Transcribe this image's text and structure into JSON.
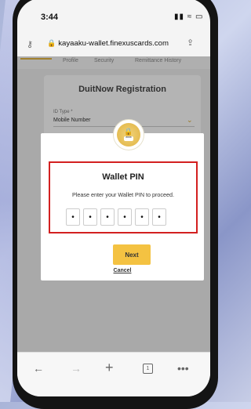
{
  "status": {
    "time": "3:44"
  },
  "browser": {
    "url": "kayaaku-wallet.finexuscards.com",
    "tabs_count": "1"
  },
  "page": {
    "tabs": [
      "",
      "Profile",
      "Security",
      "Remittance History"
    ],
    "card_title": "DuitNow Registration",
    "id_type_label": "ID Type *",
    "id_type_value": "Mobile Number"
  },
  "modal": {
    "title": "Wallet PIN",
    "description": "Please enter your Wallet PIN to proceed.",
    "pin_digits": [
      "•",
      "•",
      "•",
      "•",
      "•",
      "•"
    ],
    "next_label": "Next",
    "cancel_label": "Cancel"
  },
  "colors": {
    "accent": "#f4c242",
    "highlight": "#d32020"
  }
}
